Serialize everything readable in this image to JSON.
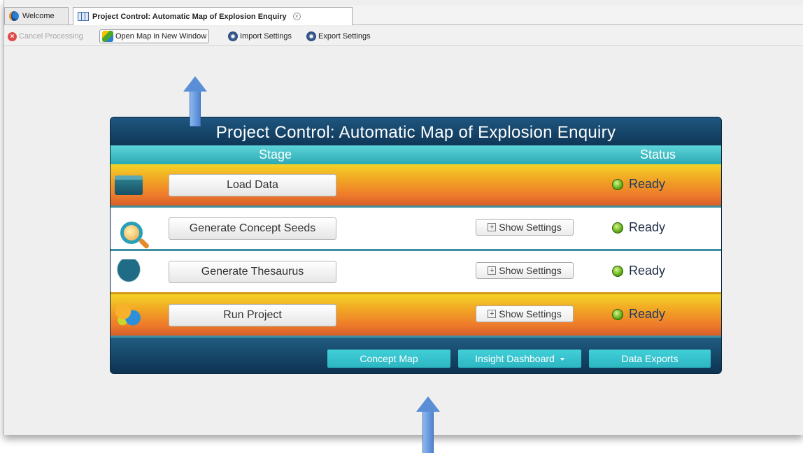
{
  "tabs": [
    {
      "label": "Welcome"
    },
    {
      "label": "Project Control: Automatic Map of Explosion Enquiry"
    }
  ],
  "toolbar": {
    "cancel_label": "Cancel Processing",
    "open_map_label": "Open Map in New Window",
    "import_label": "Import Settings",
    "export_label": "Export Settings"
  },
  "panel": {
    "title": "Project Control: Automatic Map of Explosion Enquiry",
    "stage_header": "Stage",
    "status_header": "Status",
    "stages": [
      {
        "label": "Load Data",
        "status": "Ready",
        "icon": "folder-icon"
      },
      {
        "label": "Generate Concept Seeds",
        "settings": "Show Settings",
        "status": "Ready",
        "icon": "magnifier-icon"
      },
      {
        "label": "Generate Thesaurus",
        "settings": "Show Settings",
        "status": "Ready",
        "icon": "thesaurus-icon"
      },
      {
        "label": "Run Project",
        "settings": "Show Settings",
        "status": "Ready",
        "icon": "venn-icon"
      }
    ],
    "footer": {
      "concept_map": "Concept Map",
      "insight_dashboard": "Insight Dashboard",
      "data_exports": "Data Exports"
    }
  },
  "colors": {
    "panel_dark": "#0f3a58",
    "header_cyan": "#3ebfc8",
    "hot_top": "#f4d227",
    "hot_bottom": "#d65f2a",
    "status_led": "#5fae17",
    "arrow": "#5a8fd8"
  }
}
